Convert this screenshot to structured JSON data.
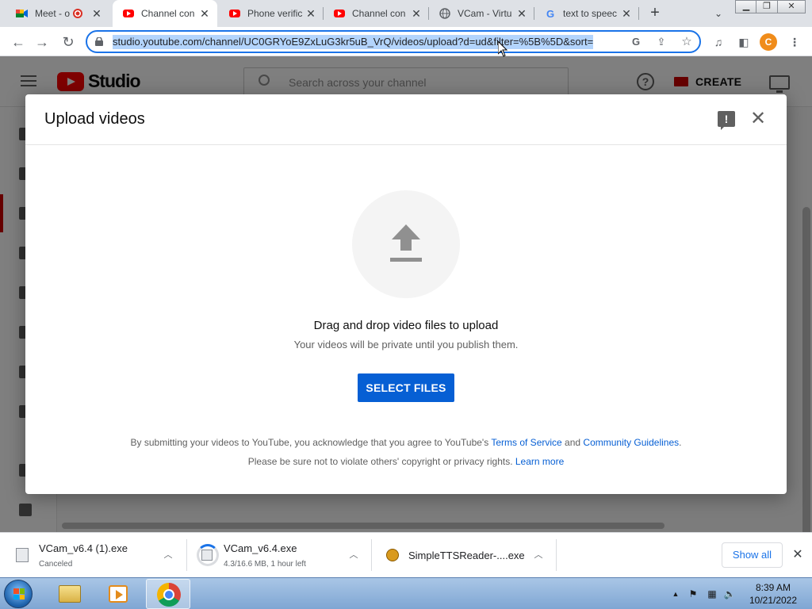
{
  "browser": {
    "tabs": [
      {
        "title": "Meet - o",
        "icon": "google-meet-icon"
      },
      {
        "title": "Channel con",
        "icon": "youtube-icon",
        "active": true
      },
      {
        "title": "Phone verific",
        "icon": "youtube-icon"
      },
      {
        "title": "Channel con",
        "icon": "youtube-icon"
      },
      {
        "title": "VCam - Virtu",
        "icon": "globe-icon"
      },
      {
        "title": "text to speec",
        "icon": "google-icon"
      }
    ],
    "url": "studio.youtube.com/channel/UC0GRYoE9ZxLuG3kr5uB_VrQ/videos/upload?d=ud&filter=%5B%5D&sort=",
    "profile_initial": "C"
  },
  "studio": {
    "logo_text": "Studio",
    "search_placeholder": "Search across your channel",
    "create_label": "CREATE"
  },
  "dialog": {
    "title": "Upload videos",
    "drag_text": "Drag and drop video files to upload",
    "private_text": "Your videos will be private until you publish them.",
    "select_button": "SELECT FILES",
    "legal_line1_prefix": "By submitting your videos to YouTube, you acknowledge that you agree to YouTube's ",
    "terms_link": "Terms of Service",
    "legal_line1_and": " and ",
    "guidelines_link": "Community Guidelines",
    "legal_line1_suffix": ".",
    "legal_line2_prefix": "Please be sure not to violate others' copyright or privacy rights. ",
    "learn_more_link": "Learn more"
  },
  "downloads": {
    "items": [
      {
        "name": "VCam_v6.4 (1).exe",
        "status": "Canceled"
      },
      {
        "name": "VCam_v6.4.exe",
        "status": "4.3/16.6 MB, 1 hour left",
        "progress": 0.26
      },
      {
        "name": "SimpleTTSReader-....exe",
        "status": ""
      }
    ],
    "show_all_label": "Show all"
  },
  "taskbar": {
    "time": "8:39 AM",
    "date": "10/21/2022"
  }
}
